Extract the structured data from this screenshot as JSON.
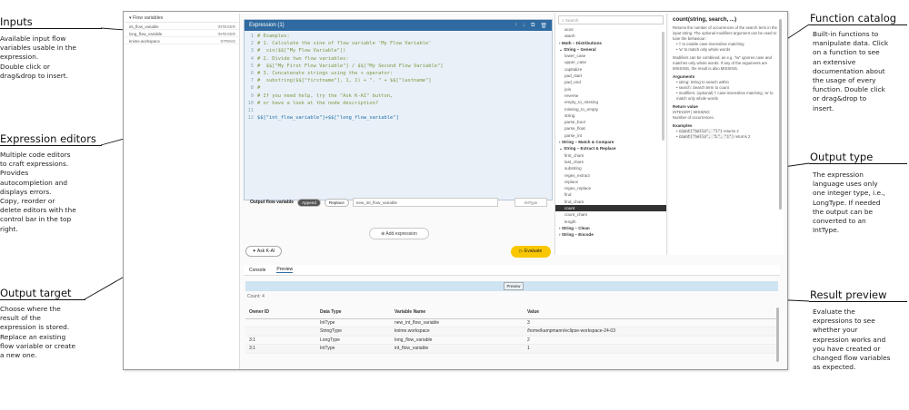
{
  "annotations": {
    "inputs": {
      "title": "Inputs",
      "body": "Available input flow\nvariables usable in the\nexpression.\nDouble click or\ndrag&drop to insert."
    },
    "editors": {
      "title": "Expression editors",
      "body": "Multiple code editors\nto craft expressions.\nProvides\nautocompletion and\ndisplays errors.\nCopy, reorder or\ndelete editors with the\ncontrol bar in the top\nright."
    },
    "target": {
      "title": "Output target",
      "body": "Choose where the\nresult of the\nexpression is stored.\nReplace an existing\nflow variable or create\na new one."
    },
    "catalog": {
      "title": "Function catalog",
      "body": "Built-in functions to\nmanipulate data. Click\non a function to see\nan extensive\ndocumentation about\nthe usage of every\nfunction. Double click\nor drag&drop to\ninsert."
    },
    "type": {
      "title": "Output type",
      "body": "The expression\nlanguage uses only\none integer type, i.e.,\nLongType. If needed\nthe output can be\nconverted to an\nIntType."
    },
    "preview": {
      "title": "Result preview",
      "body": "Evaluate the\nexpressions to see\nwhether your\nexpression works and\nyou have created or\nchanged flow variables\nas expected."
    }
  },
  "flow_variables": {
    "header": "Flow variables",
    "items": [
      {
        "name": "int_flow_variable",
        "type": "INTEGER"
      },
      {
        "name": "long_flow_variable",
        "type": "INTEGER"
      },
      {
        "name": "knime.workspace",
        "type": "STRING"
      }
    ]
  },
  "editor": {
    "title": "Expression (1)",
    "lines": [
      {
        "n": "1",
        "text": "# Examples:",
        "kind": "comment"
      },
      {
        "n": "2",
        "text": "# 1. Calculate the sine of flow variable 'My Flow Variable'",
        "kind": "comment"
      },
      {
        "n": "3",
        "text": "#  sin($$[\"My Flow Variable\"])",
        "kind": "comment"
      },
      {
        "n": "4",
        "text": "# 2. Divide two flow variables:",
        "kind": "comment"
      },
      {
        "n": "5",
        "text": "#  $$[\"My First Flow Variable\"] / $$[\"My Second Flow Variable\"]",
        "kind": "comment"
      },
      {
        "n": "6",
        "text": "# 3. Concatenate strings using the + operator:",
        "kind": "comment"
      },
      {
        "n": "7",
        "text": "#  substring($$[\"firstname\"], 1, 1) + \". \" + $$[\"lastname\"]",
        "kind": "comment"
      },
      {
        "n": "8",
        "text": "#",
        "kind": "comment"
      },
      {
        "n": "9",
        "text": "# If you need help, try the \"Ask K-AI\" button,",
        "kind": "comment"
      },
      {
        "n": "10",
        "text": "# or have a look at the node description?",
        "kind": "comment"
      },
      {
        "n": "11",
        "text": "",
        "kind": "comment"
      },
      {
        "n": "12",
        "text": "$$[\"int_flow_variable\"]+$$[\"long_flow_variable\"]",
        "kind": "expr"
      }
    ],
    "output_label": "Output flow variable",
    "append_label": "Append",
    "replace_label": "Replace",
    "output_name": "new_int_flow_variable",
    "output_type": "IntType"
  },
  "buttons": {
    "add_expression": "Add expression",
    "ask_kai": "Ask K-AI",
    "evaluate": "Evaluate",
    "preview": "Preview"
  },
  "tabs": [
    "Console",
    "Preview"
  ],
  "results": {
    "count": "Count: 4",
    "headers": [
      "Owner ID",
      "Data Type",
      "Variable Name",
      "Value"
    ],
    "rows": [
      [
        "",
        "IntType",
        "new_int_flow_variable",
        "3"
      ],
      [
        "",
        "StringType",
        "knime.workspace",
        "/home/kampmann/eclipse-workspace-24-03"
      ],
      [
        "3:1",
        "LongType",
        "long_flow_variable",
        "2"
      ],
      [
        "3:1",
        "IntType",
        "int_flow_variable",
        "1"
      ]
    ]
  },
  "functions": {
    "search_placeholder": "Search",
    "items": [
      {
        "label": "acos",
        "cat": false
      },
      {
        "label": "atanh",
        "cat": false
      },
      {
        "label": "Math – Distributions",
        "cat": true
      },
      {
        "label": "String – General",
        "cat": true
      },
      {
        "label": "lower_case",
        "cat": false
      },
      {
        "label": "upper_case",
        "cat": false
      },
      {
        "label": "capitalize",
        "cat": false
      },
      {
        "label": "pad_start",
        "cat": false
      },
      {
        "label": "pad_end",
        "cat": false
      },
      {
        "label": "join",
        "cat": false
      },
      {
        "label": "reverse",
        "cat": false
      },
      {
        "label": "empty_to_missing",
        "cat": false
      },
      {
        "label": "missing_to_empty",
        "cat": false
      },
      {
        "label": "string",
        "cat": false
      },
      {
        "label": "parse_bool",
        "cat": false
      },
      {
        "label": "parse_float",
        "cat": false
      },
      {
        "label": "parse_int",
        "cat": false
      },
      {
        "label": "String – Match & Compare",
        "cat": true
      },
      {
        "label": "String – Extract & Replace",
        "cat": true
      },
      {
        "label": "first_chars",
        "cat": false
      },
      {
        "label": "last_chars",
        "cat": false
      },
      {
        "label": "substring",
        "cat": false
      },
      {
        "label": "regex_extract",
        "cat": false
      },
      {
        "label": "replace",
        "cat": false
      },
      {
        "label": "regex_replace",
        "cat": false
      },
      {
        "label": "find",
        "cat": false
      },
      {
        "label": "find_chars",
        "cat": false
      },
      {
        "label": "count",
        "cat": false,
        "selected": true
      },
      {
        "label": "count_chars",
        "cat": false
      },
      {
        "label": "length",
        "cat": false
      },
      {
        "label": "String – Clean",
        "cat": true
      },
      {
        "label": "String – Encode",
        "cat": true
      }
    ]
  },
  "doc": {
    "title": "count(string, search, ...)",
    "intro": "Returns the number of occurrences of the search term in the input string. The optional modifiers argument can be used to tune the behaviour:",
    "mods": [
      "'i' to enable case-insensitive matching",
      "'w' to match only whole words"
    ],
    "note": "Modifiers can be combined, as e.g. \"iw\" ignores case and matches only whole words. If any of the arguments are MISSING, the result is also MISSING.",
    "args_heading": "Arguments",
    "args": [
      "string: String to search within",
      "search: Search term to count",
      "modifiers: (optional) 'i' case-insensitive matching, 'w' to match only whole words"
    ],
    "return_heading": "Return value",
    "return_type": "INTEGER | MISSING",
    "return_desc": "Number of occurrences.",
    "examples_heading": "Examples",
    "examples": [
      {
        "code": "count(\"hello\", \"l\")",
        "desc": "returns 2"
      },
      {
        "code": "count(\"hello\", \"L\", \"i\")",
        "desc": "returns 2"
      }
    ]
  }
}
